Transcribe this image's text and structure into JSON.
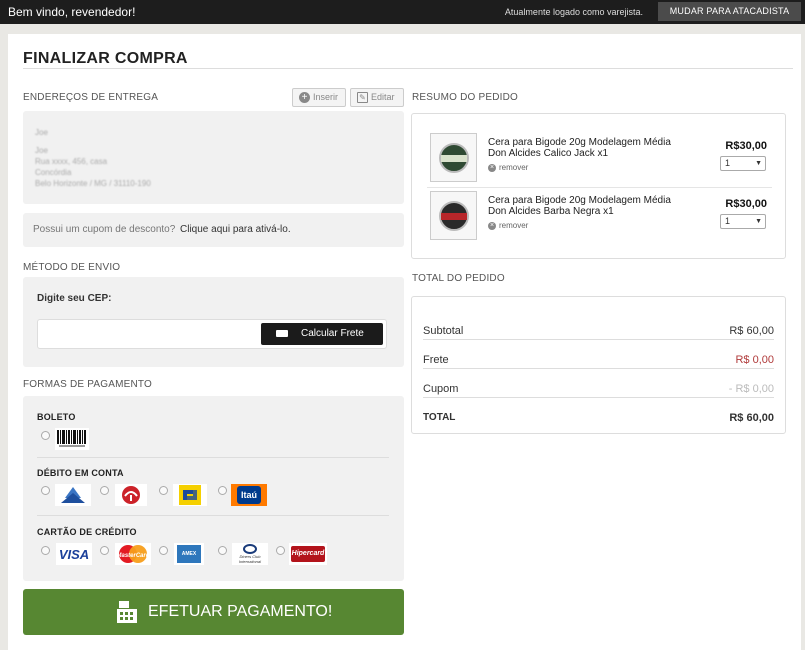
{
  "topbar": {
    "welcome": "Bem vindo, revendedor!",
    "logged_as": "Atualmente logado como varejista.",
    "switch_button": "MUDAR PARA ATACADISTA"
  },
  "page": {
    "title": "FINALIZAR COMPRA"
  },
  "delivery": {
    "label": "ENDEREÇOS DE ENTREGA",
    "insert_button": "Inserir",
    "edit_button": "Editar",
    "address_lines": [
      "Joe",
      "Joe",
      "Rua xxxx, 456, casa",
      "Concórdia",
      "Belo Horizonte / MG / 31110-190"
    ]
  },
  "coupon": {
    "question": "Possui um cupom de desconto?",
    "link": "Clique aqui para ativá-lo."
  },
  "shipping": {
    "label": "MÉTODO DE ENVIO",
    "cep_label": "Digite seu CEP:",
    "calc_button": "Calcular Frete"
  },
  "payment": {
    "label": "FORMAS DE PAGAMENTO",
    "boleto_head": "BOLETO",
    "debit_head": "DÉBITO EM CONTA",
    "credit_head": "CARTÃO DE CRÉDITO",
    "debit_banks": [
      "caixa-logo",
      "bradesco-logo",
      "banco-do-brasil-logo",
      "itau-logo"
    ],
    "itau_text": "Itaú",
    "visa_text": "VISA",
    "mastercard_text": "MasterCard",
    "amex_text": "AMEX",
    "diners_text": "Diners Club International",
    "hipercard_text": "Hipercard",
    "submit_button": "EFETUAR PAGAMENTO!"
  },
  "summary": {
    "label": "RESUMO DO PEDIDO",
    "items": [
      {
        "name": "Cera para Bigode 20g Modelagem Média Don Alcides Calico Jack x1",
        "price": "R$30,00",
        "qty": "1",
        "remove": "remover"
      },
      {
        "name": "Cera para Bigode 20g Modelagem Média Don Alcides Barba Negra x1",
        "price": "R$30,00",
        "qty": "1",
        "remove": "remover"
      }
    ]
  },
  "totals": {
    "label": "TOTAL DO PEDIDO",
    "rows": [
      {
        "k": "Subtotal",
        "v": "R$ 60,00"
      },
      {
        "k": "Frete",
        "v": "R$ 0,00"
      },
      {
        "k": "Cupom",
        "v": "- R$ 0,00"
      },
      {
        "k": "TOTAL",
        "v": "R$ 60,00"
      }
    ]
  },
  "colors": {
    "accent_green": "#578732",
    "freight_red": "#b03a3a",
    "dark": "#1d1d1d"
  }
}
